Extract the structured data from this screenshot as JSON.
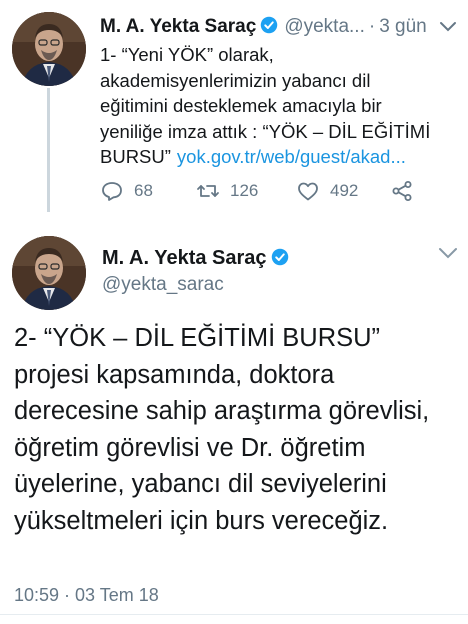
{
  "tweet1": {
    "author_name": "M. A. Yekta Saraç",
    "handle": "@yekta...",
    "separator": "·",
    "time": "3 gün",
    "text": "1- “Yeni YÖK” olarak, akademisyenlerimizin yabancı dil eğitimini desteklemek amacıyla bir yeniliğe imza attık : “YÖK – DİL EĞİTİMİ BURSU”",
    "link": "yok.gov.tr/web/guest/akad...",
    "replies": "68",
    "retweets": "126",
    "likes": "492"
  },
  "tweet2": {
    "author_name": "M. A. Yekta Saraç",
    "handle": "@yekta_sarac",
    "text": "2- “YÖK – DİL EĞİTİMİ BURSU” projesi kapsamında, doktora derecesine sahip araştırma görevlisi, öğretim görevlisi ve Dr. öğretim üyelerine, yabancı dil seviyelerini yükseltmeleri için burs vereceğiz.",
    "timestamp": "10:59 · 03 Tem 18"
  },
  "colors": {
    "text": "#14171a",
    "secondary": "#657786",
    "link": "#1b95e0",
    "verified": "#1da1f2",
    "thread_line": "#ccd6dd"
  },
  "icons": {
    "avatar": "profile-photo",
    "verified": "verified-badge-icon",
    "more": "chevron-down-icon",
    "reply": "reply-icon",
    "retweet": "retweet-icon",
    "like": "heart-icon",
    "share": "share-icon"
  }
}
